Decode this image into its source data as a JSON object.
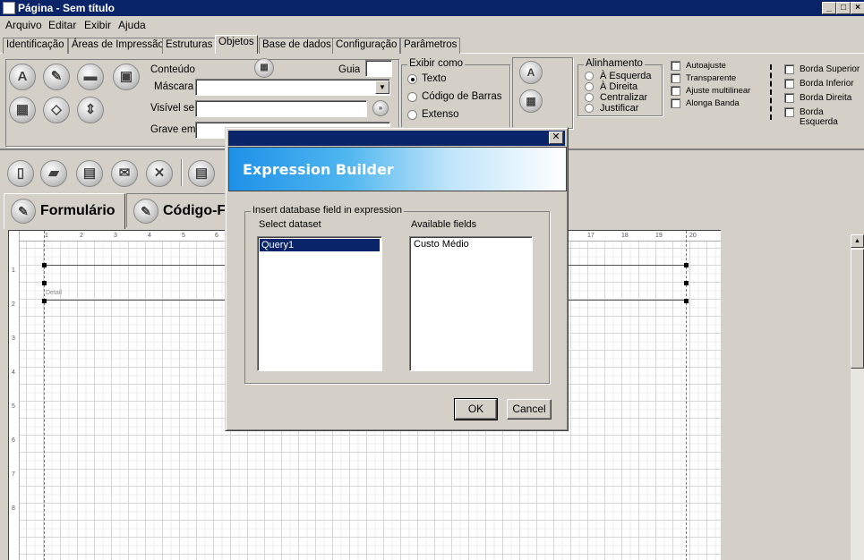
{
  "window": {
    "title": "Página - Sem título"
  },
  "menu": [
    "Arquivo",
    "Editar",
    "Exibir",
    "Ajuda"
  ],
  "tabs": [
    "Identificação",
    "Áreas de Impressão",
    "Estruturas",
    "Objetos",
    "Base de dados",
    "Configuração",
    "Parâmetros"
  ],
  "objetos": {
    "conteudo_label": "Conteúdo",
    "guia_label": "Guia",
    "mascara_label": "Máscara",
    "visivel_label": "Visível se",
    "grave_label": "Grave em",
    "guia_value": "",
    "mascara_value": "",
    "visivel_value": "",
    "grave_value": ""
  },
  "exibir_como": {
    "title": "Exibir como",
    "options": [
      "Texto",
      "Código de Barras",
      "Extenso"
    ],
    "selected": "Texto"
  },
  "alinhamento": {
    "title": "Alinhamento",
    "options": [
      "À Esquerda",
      "À Direita",
      "Centralizar",
      "Justificar"
    ]
  },
  "checks": [
    "Autoajuste",
    "Transparente",
    "Ajuste multilinear",
    "Alonga Banda"
  ],
  "bordas": [
    "Borda Superior",
    "Borda Inferior",
    "Borda Direita",
    "Borda Esquerda"
  ],
  "form_tabs": [
    "Formulário",
    "Código-F"
  ],
  "canvas": {
    "band_label": "Detail",
    "ruler_top": [
      "1",
      "2",
      "3",
      "4",
      "5",
      "6",
      "17",
      "18",
      "19",
      "20"
    ],
    "ruler_left": [
      "1",
      "2",
      "3",
      "4",
      "5",
      "6",
      "7",
      "8"
    ]
  },
  "dialog": {
    "title": "",
    "header": "Expression Builder",
    "group_title": "Insert database field in expression",
    "dataset_label": "Select dataset",
    "fields_label": "Available fields",
    "datasets": [
      "Query1"
    ],
    "fields": [
      "Custo Médio"
    ],
    "ok": "OK",
    "cancel": "Cancel"
  },
  "icons": [
    "text-icon",
    "pen-icon",
    "computer-icon",
    "image-icon",
    "calculator-icon",
    "shapes-icon",
    "updown-icon",
    "new-icon",
    "open-icon",
    "save-icon",
    "mail-icon",
    "delete-icon",
    "print-icon"
  ]
}
